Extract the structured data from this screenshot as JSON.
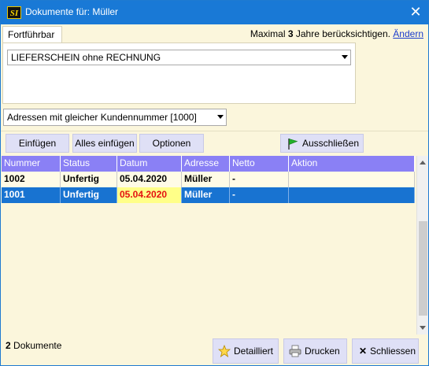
{
  "window": {
    "title": "Dokumente für: Müller",
    "app_icon_text": "SI",
    "close_symbol": "✕"
  },
  "tab": {
    "label": "Fortführbar"
  },
  "hint": {
    "prefix": "Maximal ",
    "years": "3",
    "suffix": " Jahre berücksichtigen.",
    "change_link": "Ändern"
  },
  "document_type_select": {
    "value": "LIEFERSCHEIN ohne RECHNUNG"
  },
  "address_filter_select": {
    "value": "Adressen mit gleicher Kundennummer [1000]"
  },
  "toolbar": {
    "insert": "Einfügen",
    "insert_all": "Alles einfügen",
    "options": "Optionen",
    "exclude": "Ausschließen"
  },
  "table": {
    "columns": [
      "Nummer",
      "Status",
      "Datum",
      "Adresse",
      "Netto",
      "Aktion"
    ],
    "rows": [
      [
        "1002",
        "Unfertig",
        "05.04.2020",
        "Müller",
        "-",
        ""
      ],
      [
        "1001",
        "Unfertig",
        "05.04.2020",
        "Müller",
        "-",
        ""
      ]
    ],
    "selected_row": 1
  },
  "footer": {
    "count": "2",
    "count_label": " Dokumente",
    "detail_button": "Detailliert",
    "print_button": "Drucken",
    "close_button": "Schliessen"
  },
  "colors": {
    "title_bar": "#1979d6",
    "header_bg": "#8a80f5",
    "selected_row": "#1873d1",
    "date_highlight_bg": "#ffff88",
    "date_highlight_text": "#e41010",
    "button_bg": "#dfe0f6",
    "window_bg": "#fbf6dc"
  }
}
